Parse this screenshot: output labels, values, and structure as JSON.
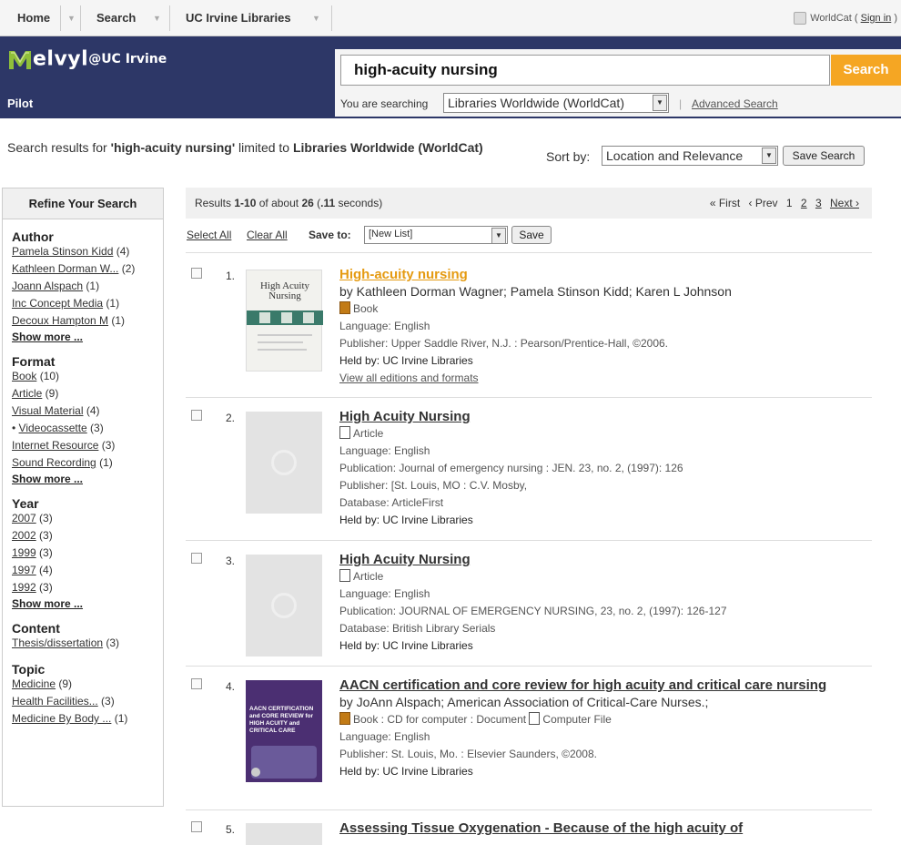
{
  "topnav": {
    "home": "Home",
    "search": "Search",
    "library": "UC Irvine Libraries",
    "worldcat_prefix": "WorldCat (",
    "sign_in": "Sign in",
    "worldcat_suffix": ")"
  },
  "header": {
    "logo_text": "elvyl",
    "logo_sub": "@UC Irvine",
    "pilot": "Pilot",
    "search_value": "high-acuity nursing",
    "search_button": "Search",
    "you_are_searching": "You are searching",
    "scope": "Libraries Worldwide (WorldCat)",
    "advanced_search": "Advanced Search"
  },
  "summary": {
    "prefix": "Search results for ",
    "query": "'high-acuity nursing'",
    "middle": " limited to ",
    "scope": "Libraries Worldwide (WorldCat)",
    "sort_by": "Sort by:",
    "sort_value": "Location and Relevance",
    "save_search": "Save Search"
  },
  "sidebar": {
    "title": "Refine Your Search",
    "facets": [
      {
        "title": "Author",
        "items": [
          "Pamela Stinson Kidd (4)",
          "Kathleen Dorman W... (2)",
          "Joann Alspach (1)",
          "Inc Concept Media (1)",
          "Decoux Hampton M (1)"
        ],
        "more": "Show more ..."
      },
      {
        "title": "Format",
        "items": [
          "Book (10)",
          "Article (9)",
          "Visual Material (4)",
          "• Videocassette (3)",
          "Internet Resource (3)",
          "Sound Recording (1)"
        ],
        "more": "Show more ..."
      },
      {
        "title": "Year",
        "items": [
          "2007 (3)",
          "2002 (3)",
          "1999 (3)",
          "1997 (4)",
          "1992 (3)"
        ],
        "more": "Show more ..."
      },
      {
        "title": "Content",
        "items": [
          "Thesis/dissertation (3)"
        ],
        "more": ""
      },
      {
        "title": "Topic",
        "items": [
          "Medicine (9)",
          "Health Facilities... (3)",
          "Medicine By Body ... (1)"
        ],
        "more": ""
      }
    ]
  },
  "results": {
    "count_prefix": "Results ",
    "range": "1-10",
    "count_mid": " of about ",
    "total": "26",
    "time_prefix": " (",
    "time": ".11",
    "time_suffix": " seconds)",
    "first": "« First",
    "prev": "‹ Prev",
    "pages": [
      "1",
      "2",
      "3"
    ],
    "next": "Next ›",
    "select_all": "Select All",
    "clear_all": "Clear All",
    "save_to": "Save to:",
    "list_value": "[New List]",
    "save": "Save"
  },
  "records": [
    {
      "num": "1.",
      "title": "High-acuity nursing",
      "authors": "by Kathleen Dorman Wagner; Pamela Stinson Kidd; Karen L Johnson",
      "format": "Book",
      "language": "Language: English",
      "publisher": "Publisher: Upper Saddle River, N.J. : Pearson/Prentice-Hall, ©2006.",
      "held": "Held by: UC Irvine Libraries",
      "editions": "View all editions and formats",
      "cover_title": "High Acuity Nursing"
    },
    {
      "num": "2.",
      "title": "High Acuity Nursing",
      "format": "Article",
      "language": "Language: English",
      "publication": "Publication: Journal of emergency nursing : JEN. 23, no. 2, (1997): 126",
      "publisher": "Publisher: [St. Louis, MO : C.V. Mosby,",
      "database": "Database: ArticleFirst",
      "held": "Held by: UC Irvine Libraries"
    },
    {
      "num": "3.",
      "title": "High Acuity Nursing",
      "format": "Article",
      "language": "Language: English",
      "publication": "Publication: JOURNAL OF EMERGENCY NURSING, 23, no. 2, (1997): 126-127",
      "database": "Database: British Library Serials",
      "held": "Held by: UC Irvine Libraries"
    },
    {
      "num": "4.",
      "title": "AACN certification and core review for high acuity and critical care nursing",
      "authors": "by JoAnn Alspach; American Association of Critical-Care Nurses.;",
      "format": "Book : CD for computer : Document",
      "format2": "Computer File",
      "language": "Language: English",
      "publisher": "Publisher: St. Louis, Mo. : Elsevier Saunders, ©2008.",
      "held": "Held by: UC Irvine Libraries",
      "cover_title": "AACN CERTIFICATION and CORE REVIEW for HIGH ACUITY and CRITICAL CARE"
    },
    {
      "num": "5.",
      "title": "Assessing Tissue Oxygenation - Because of the high acuity of"
    }
  ],
  "colors": {
    "header_bg": "#2d3767",
    "search_button": "#f5a623",
    "title_highlight": "#e59b12",
    "logo_m": "#8fbf3a"
  }
}
